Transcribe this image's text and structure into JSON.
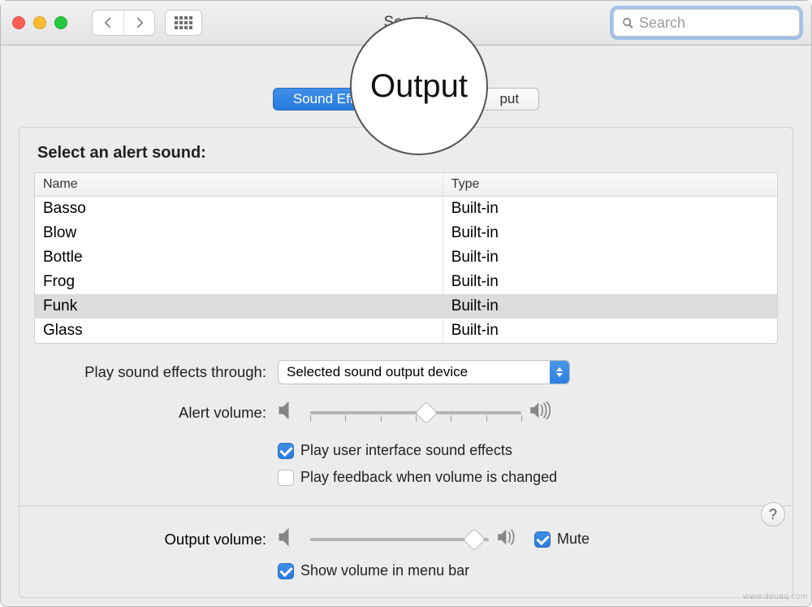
{
  "window": {
    "title": "Sound"
  },
  "search": {
    "placeholder": "Search"
  },
  "tabs": {
    "effects": "Sound Effects",
    "output": "Output",
    "input": "Input",
    "input_fragment": "put"
  },
  "section_label": "Select an alert sound:",
  "columns": {
    "name": "Name",
    "type": "Type"
  },
  "sounds": [
    {
      "name": "Basso",
      "type": "Built-in",
      "selected": false
    },
    {
      "name": "Blow",
      "type": "Built-in",
      "selected": false
    },
    {
      "name": "Bottle",
      "type": "Built-in",
      "selected": false
    },
    {
      "name": "Frog",
      "type": "Built-in",
      "selected": false
    },
    {
      "name": "Funk",
      "type": "Built-in",
      "selected": true
    },
    {
      "name": "Glass",
      "type": "Built-in",
      "selected": false
    }
  ],
  "through_label": "Play sound effects through:",
  "through_value": "Selected sound output device",
  "alert_volume": {
    "label": "Alert volume:",
    "value": 55
  },
  "checkboxes": {
    "ui_sounds": {
      "label": "Play user interface sound effects",
      "checked": true
    },
    "feedback": {
      "label": "Play feedback when volume is changed",
      "checked": false
    },
    "show_menu": {
      "label": "Show volume in menu bar",
      "checked": true
    },
    "mute": {
      "label": "Mute",
      "checked": true
    }
  },
  "output_volume": {
    "label": "Output volume:",
    "value": 92
  },
  "help": "?",
  "callout": {
    "text": "Output"
  },
  "watermark": "www.deuaq.com"
}
